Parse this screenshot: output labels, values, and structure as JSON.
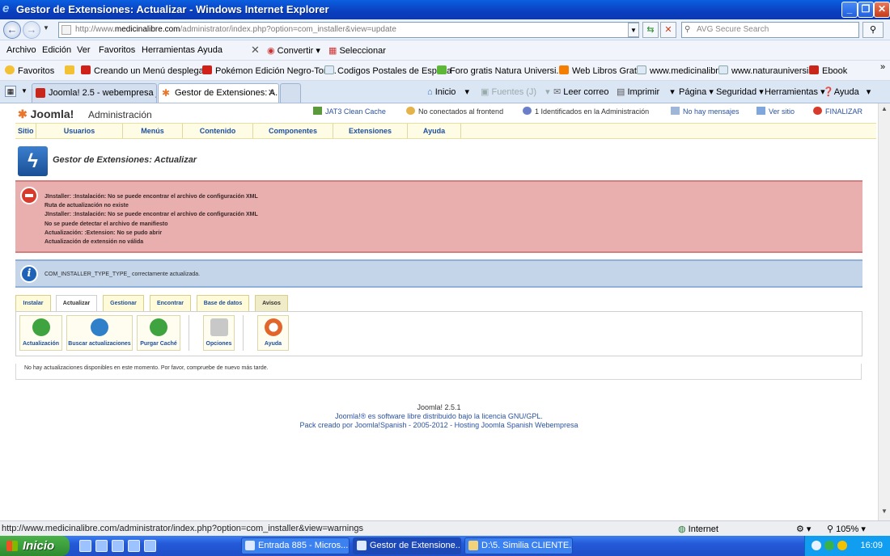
{
  "window": {
    "title": "Gestor de Extensiones: Actualizar - Windows Internet Explorer",
    "minimize": "_",
    "maximize": "❐",
    "close": "✕"
  },
  "address": {
    "url_prefix": "http://www.",
    "url_domain": "medicinalibre.com",
    "url_rest": "/administrator/index.php?option=com_installer&view=update",
    "search_placeholder": "AVG Secure Search"
  },
  "menubar": {
    "items": [
      "Archivo",
      "Edición",
      "Ver",
      "Favoritos",
      "Herramientas",
      "Ayuda"
    ],
    "convertir": "Convertir",
    "seleccionar": "Seleccionar"
  },
  "favorites": {
    "label": "Favoritos",
    "items": [
      "Creando un Menú desplega...",
      "Pokémon Edición Negro-Torr...",
      "Codigos Postales de España",
      "Foro gratis Natura Universi...",
      "Web Libros Gratis",
      "www.medicinalibre",
      "www.naturauniversia",
      "Ebook"
    ]
  },
  "tabs": {
    "items": [
      "Joomla! 2.5 - webempresa jo...",
      "Gestor de Extensiones: A..."
    ],
    "commands": [
      "Inicio",
      "Fuentes (J)",
      "Leer correo",
      "Imprimir",
      "Página",
      "Seguridad",
      "Herramientas",
      "Ayuda"
    ]
  },
  "joomla": {
    "logo": "Joomla!",
    "admin_label": "Administración",
    "status": {
      "cache": "JAT3 Clean Cache",
      "frontend": "No conectados al frontend",
      "admin_users": "1 Identificados en la Administración",
      "messages": "No hay mensajes",
      "view_site": "Ver sitio",
      "logout": "FINALIZAR"
    },
    "menu": [
      "Sitio",
      "Usuarios",
      "Menús",
      "Contenido",
      "Componentes",
      "Extensiones",
      "Ayuda"
    ],
    "page_title": "Gestor de Extensiones: Actualizar",
    "errors": [
      "JInstaller: :Instalación: No se puede encontrar el archivo de configuración XML",
      "Ruta de actualización no existe",
      "JInstaller: :Instalación: No se puede encontrar el archivo de configuración XML",
      "No se puede detectar el archivo de manifiesto",
      "Actualización: :Extension: No se pudo abrir",
      "Actualización de extensión no válida"
    ],
    "info": "COM_INSTALLER_TYPE_TYPE_ correctamente actualizada.",
    "subtabs": [
      "Instalar",
      "Actualizar",
      "Gestionar",
      "Encontrar",
      "Base de datos",
      "Avisos"
    ],
    "toolbar": {
      "update": "Actualización",
      "find_updates": "Buscar actualizaciones",
      "purge_cache": "Purgar Caché",
      "options": "Opciones",
      "help": "Ayuda"
    },
    "no_updates": "No hay actualizaciones disponibles en este momento. Por favor, compruebe de nuevo más tarde.",
    "footer": {
      "version": "Joomla! 2.5.1",
      "license": "Joomla!® es software libre distribuido bajo la licencia GNU/GPL.",
      "credits": "Pack creado por Joomla!Spanish - 2005-2012 - Hosting Joomla Spanish Webempresa"
    }
  },
  "statusbar": {
    "url": "http://www.medicinalibre.com/administrator/index.php?option=com_installer&view=warnings",
    "zone": "Internet",
    "zoom": "105%"
  },
  "taskbar": {
    "start": "Inicio",
    "tasks": [
      "Entrada 885 - Micros...",
      "Gestor de Extensione...",
      "D:\\5. Similia CLIENTE..."
    ],
    "clock": "16:09"
  },
  "colors": {
    "error_bg": "#e9aeae",
    "info_bg": "#c4d5ea",
    "joomla_link": "#1c4f9e",
    "menu_bg": "#fffce6"
  }
}
